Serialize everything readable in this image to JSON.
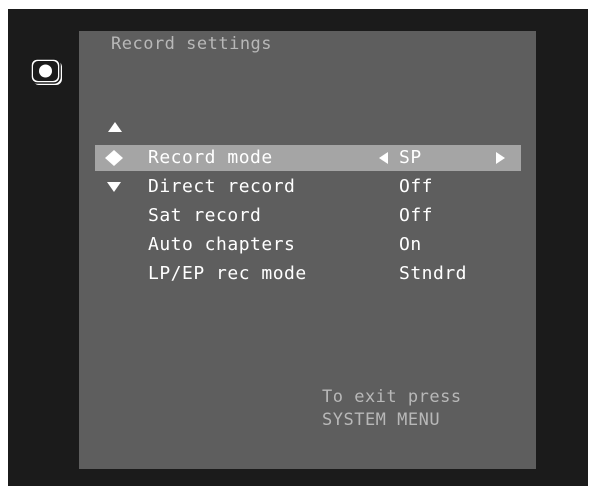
{
  "menu": {
    "title": "Record settings",
    "rows": [
      {
        "label": "Record mode",
        "value": "SP"
      },
      {
        "label": "Direct record",
        "value": "Off"
      },
      {
        "label": "Sat record",
        "value": "Off"
      },
      {
        "label": "Auto chapters",
        "value": "On"
      },
      {
        "label": "LP/EP rec mode",
        "value": "Stndrd"
      }
    ]
  },
  "footer": {
    "line1": "To exit press",
    "line2": "SYSTEM MENU"
  },
  "icons": {
    "record": "record-icon",
    "scroll_up": "triangle-up-icon",
    "scroll_down": "triangle-down-icon",
    "selector": "diamond-icon",
    "value_left": "triangle-left-icon",
    "value_right": "triangle-right-icon"
  },
  "colors": {
    "screen_bg": "#1b1b1b",
    "panel_bg": "#5e5e5e",
    "highlight_bg": "#a5a5a5",
    "text": "#ffffff",
    "dim_text": "#b8b8b8"
  }
}
